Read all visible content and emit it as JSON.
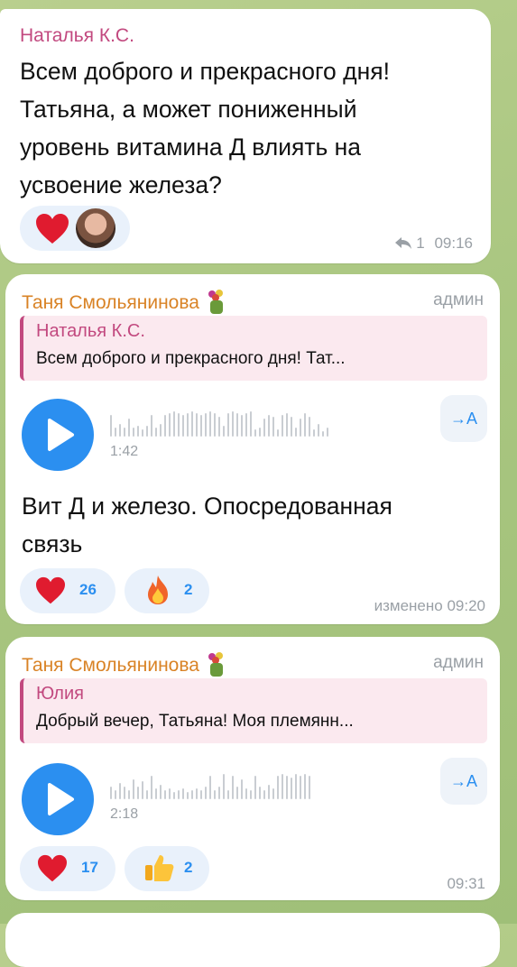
{
  "colors": {
    "accent": "#2b8ff0",
    "sender_pink": "#c2497f",
    "sender_orange": "#d98326",
    "bubble": "#ffffff"
  },
  "messages": [
    {
      "sender": "Наталья К.С.",
      "text_lines": [
        "Всем доброго и прекрасного дня!",
        "Татьяна, а может пониженный",
        "уровень витамина Д влиять на",
        "усвоение железа?"
      ],
      "reactions": [
        {
          "icon": "heart-icon"
        },
        {
          "icon": "avatar"
        }
      ],
      "reply_count": "1",
      "time": "09:16"
    },
    {
      "sender": "Таня Смольянинова",
      "role": "админ",
      "quote": {
        "name": "Наталья К.С.",
        "text": "Всем доброго и прекрасного дня! Тат..."
      },
      "voice": {
        "duration": "1:42",
        "translate": "→A"
      },
      "text_lines": [
        "Вит Д и железо. Опосредованная",
        "связь"
      ],
      "reactions": [
        {
          "icon": "heart-icon",
          "count": "26"
        },
        {
          "icon": "fire-icon",
          "count": "2"
        }
      ],
      "meta": "изменено 09:20"
    },
    {
      "sender": "Таня Смольянинова",
      "role": "админ",
      "quote": {
        "name": "Юлия",
        "text": "Добрый вечер, Татьяна! Моя племянн..."
      },
      "voice": {
        "duration": "2:18",
        "translate": "→A"
      },
      "reactions": [
        {
          "icon": "heart-icon",
          "count": "17"
        },
        {
          "icon": "thumbs-up-icon",
          "count": "2"
        }
      ],
      "time": "09:31"
    }
  ]
}
